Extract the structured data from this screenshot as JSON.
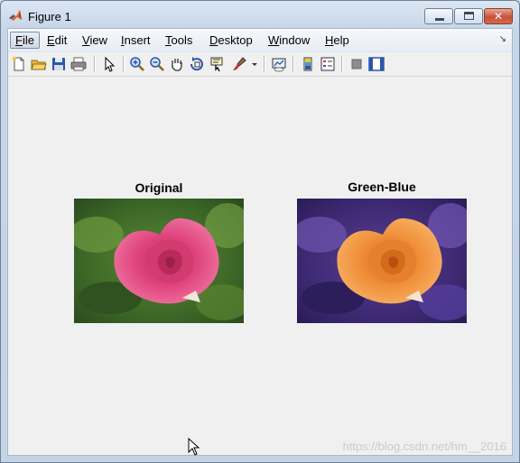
{
  "window": {
    "title": "Figure 1",
    "minimize_label": "",
    "close_label": "✕"
  },
  "menu": [
    {
      "label": "File",
      "mnemonic": "F",
      "rest": "ile"
    },
    {
      "label": "Edit",
      "mnemonic": "E",
      "rest": "dit"
    },
    {
      "label": "View",
      "mnemonic": "V",
      "rest": "iew"
    },
    {
      "label": "Insert",
      "mnemonic": "I",
      "rest": "nsert"
    },
    {
      "label": "Tools",
      "mnemonic": "T",
      "rest": "ools"
    },
    {
      "label": "Desktop",
      "mnemonic": "D",
      "rest": "esktop"
    },
    {
      "label": "Window",
      "mnemonic": "W",
      "rest": "indow"
    },
    {
      "label": "Help",
      "mnemonic": "H",
      "rest": "elp"
    }
  ],
  "toolbar": {
    "icons": [
      "new-figure-icon",
      "open-file-icon",
      "save-icon",
      "print-icon",
      "edit-plot-icon",
      "zoom-in-icon",
      "zoom-out-icon",
      "pan-icon",
      "rotate-3d-icon",
      "data-cursor-icon",
      "brush-icon",
      "link-plot-icon",
      "insert-colorbar-icon",
      "insert-legend-icon",
      "hide-plot-tools-icon",
      "show-plot-tools-icon"
    ]
  },
  "axes": [
    {
      "title": "Original",
      "colors": {
        "flower": "#e0457e",
        "background": "#3f6b2a"
      }
    },
    {
      "title": "Green-Blue",
      "colors": {
        "flower": "#f0903a",
        "background": "#3c2870"
      }
    }
  ],
  "watermark": "https://blog.csdn.net/hm__2016",
  "colors": {
    "titlebar": "#c7d6e8",
    "close_button": "#c8503c",
    "client_bg": "#f0f0f0"
  }
}
